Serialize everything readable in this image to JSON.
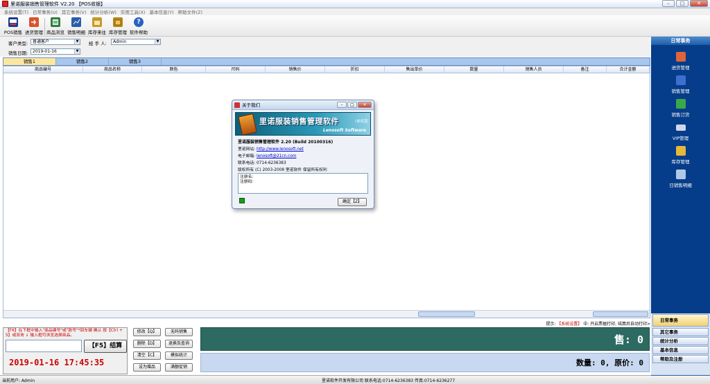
{
  "window": {
    "title": "里诺服装销售管理软件 V2.20 【POS收银】"
  },
  "menu": [
    "系统设置(T)",
    "日常事务(U)",
    "其它事务(V)",
    "统计分析(W)",
    "实用工具(X)",
    "基本信息(Y)",
    "帮助文件(Z)"
  ],
  "toolbar": [
    {
      "label": "POS销售",
      "icon": "pos-register-icon",
      "color": "#1a3d8f"
    },
    {
      "label": "进货管理",
      "icon": "stock-in-icon",
      "color": "#d9532b"
    },
    {
      "label": "商品浏览",
      "icon": "goods-browse-icon",
      "color": "#3a7a3a"
    },
    {
      "label": "销售明细",
      "icon": "sales-detail-icon",
      "color": "#2b5ea8"
    },
    {
      "label": "库存来往",
      "icon": "inventory-flow-icon",
      "color": "#c49a2c"
    },
    {
      "label": "库存管理",
      "icon": "inventory-icon",
      "color": "#b8861c"
    },
    {
      "label": "软件帮助",
      "icon": "help-icon",
      "color": "#2b62c0"
    }
  ],
  "form": {
    "customer_type_label": "客户类型:",
    "customer_type_value": "普通客户",
    "handler_label": "经 手 人:",
    "handler_value": "Admin",
    "sale_date_label": "销售日期:",
    "sale_date_value": "2019-01-16"
  },
  "tabs": [
    "销售1",
    "销售2",
    "销售3"
  ],
  "grid_columns": [
    "商品编号",
    "商品名称",
    "颜色",
    "尺码",
    "销售价",
    "折扣",
    "售出单价",
    "数量",
    "销售人员",
    "备注",
    "合计金额"
  ],
  "notice": {
    "prefix": "提示:",
    "red": "【系统设置】",
    "suffix": "中: 开启票据打印, 结算后自动打印>"
  },
  "hint": "【F6】在下框中输入\"商品编号\"或\"款号\"*回车键 确认 按【Ctrl + S】或双击 ↓ 输入框可浏览选择商品。",
  "f5_button": "【F5】结算",
  "clock": "2019-01-16  17:45:35",
  "buttons": [
    [
      "修改【Q】",
      "无码销售"
    ],
    [
      "删除【D】",
      "退换及查询"
    ],
    [
      "清空【C】",
      "模拟统计"
    ],
    [
      "设为赠品",
      "满额促销"
    ]
  ],
  "sale_display": "售:   0",
  "qty_display": "数量: 0, 原价: 0",
  "statusbar": {
    "user": "当前用户: Admin",
    "company": "里诺软件开发有限公司  联系电话:0714-6236383  传真:0714-6236277"
  },
  "right_panel": {
    "title": "日常事务",
    "items": [
      {
        "label": "进货管理",
        "icon": "stock-in-icon",
        "color": "#e0643a"
      },
      {
        "label": "销售管理",
        "icon": "sales-manage-icon",
        "color": "#3c6fd0"
      },
      {
        "label": "销售订货",
        "icon": "sales-order-icon",
        "color": "#3aa84a"
      },
      {
        "label": "VIP管理",
        "icon": "vip-card-icon",
        "color": "#d0d8e8"
      },
      {
        "label": "库存管理",
        "icon": "inventory-icon",
        "color": "#e6b93a"
      },
      {
        "label": "日销售明细",
        "icon": "daily-sales-icon",
        "color": "#b0c8e8"
      }
    ],
    "bottom": [
      "日常事务",
      "其它事务",
      "统计分析",
      "基本信息",
      "帮助及注册"
    ]
  },
  "dialog": {
    "title": "关于我们",
    "banner_title": "里诺服装销售管理软件",
    "banner_sub": "(单机版",
    "banner_en": "Lenosoft Software",
    "product": "里诺服装销售管理软件 2.20 (Build 20100316)",
    "website_label": "里诺网站:",
    "website": "http://www.lenosoft.net",
    "email_label": "电子邮箱:",
    "email": "lenosoft@21cn.com",
    "phone_label": "联系电话:",
    "phone": "0714-6236383",
    "copyright": "版权所有 (C) 2003-2008 里诺软件 保留所有权利",
    "reg1": "注册名:",
    "reg2": "注册码:",
    "ok": "确定【Z】"
  }
}
